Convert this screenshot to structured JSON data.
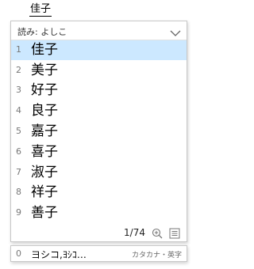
{
  "composition": {
    "text": "佳子"
  },
  "reading": {
    "label": "読み: よしこ"
  },
  "candidates": [
    {
      "num": "1",
      "text": "佳子"
    },
    {
      "num": "2",
      "text": "美子"
    },
    {
      "num": "3",
      "text": "好子"
    },
    {
      "num": "4",
      "text": "良子"
    },
    {
      "num": "5",
      "text": "嘉子"
    },
    {
      "num": "6",
      "text": "喜子"
    },
    {
      "num": "7",
      "text": "淑子"
    },
    {
      "num": "8",
      "text": "祥子"
    },
    {
      "num": "9",
      "text": "善子"
    }
  ],
  "status": {
    "page": "1/74"
  },
  "extra": {
    "num": "0",
    "text": "ヨシコ,ﾖｼｺ…",
    "hint": "カタカナ・英字"
  },
  "colors": {
    "selected_bg": "#cce8ff",
    "border": "#c8c8c8"
  }
}
